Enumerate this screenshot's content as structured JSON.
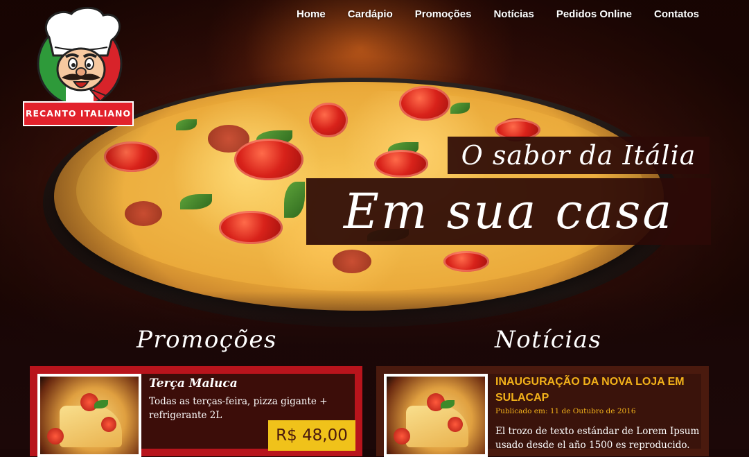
{
  "nav": {
    "items": [
      "Home",
      "Cardápio",
      "Promoções",
      "Notícias",
      "Pedidos Online",
      "Contatos"
    ]
  },
  "logo": {
    "badge_text": "RECANTO ITALIANO",
    "icon": "chef-mascot-icon"
  },
  "hero": {
    "slogan_line1": "O sabor da Itália",
    "slogan_line2": "Em sua casa"
  },
  "promotions": {
    "heading": "Promoções",
    "items": [
      {
        "title": "Terça Maluca",
        "description": "Todas as terças-feira, pizza gigante + refrigerante 2L",
        "price": "R$ 48,00",
        "image": "pizza-slice-image"
      }
    ]
  },
  "news": {
    "heading": "Notícias",
    "items": [
      {
        "title": "INAUGURAÇÃO DA NOVA LOJA EM SULACAP",
        "date": "Publicado em: 11 de Outubro de 2016",
        "body": "El trozo de texto estándar de Lorem Ipsum usado desde el año 1500 es reproducido.",
        "image": "pizza-slice-image"
      }
    ]
  },
  "colors": {
    "brand_red": "#e2222c",
    "price_yellow": "#f0c21a",
    "news_title": "#f3b21a",
    "background": "#1a0707"
  }
}
